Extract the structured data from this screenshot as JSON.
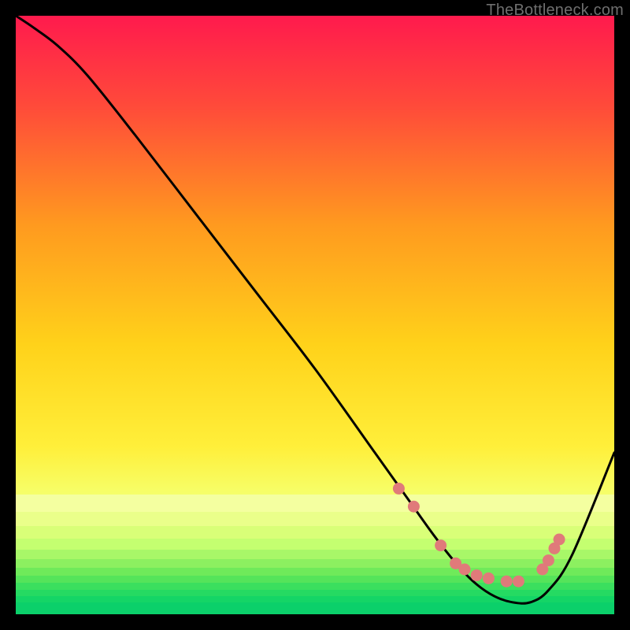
{
  "attribution": "TheBottleneck.com",
  "colors": {
    "gradient_top": "#ff1a4d",
    "gradient_mid_top": "#ff9a1f",
    "gradient_mid": "#ffe61a",
    "gradient_mid_bottom": "#f4ff6a",
    "gradient_bottom": "#13e06a",
    "frame": "#000000",
    "curve": "#000000",
    "dot_fill": "#e07a7a",
    "dot_stroke": "#b74b4b"
  },
  "chart_data": {
    "type": "line",
    "title": "",
    "xlabel": "",
    "ylabel": "",
    "xlim": [
      0,
      100
    ],
    "ylim": [
      0,
      100
    ],
    "series": [
      {
        "name": "bottleneck-curve",
        "x": [
          0,
          3,
          7,
          12,
          20,
          30,
          40,
          50,
          60,
          65,
          70,
          74,
          77,
          80,
          83,
          86,
          89,
          93,
          100
        ],
        "y": [
          100,
          98,
          95,
          90,
          80,
          67,
          54,
          41,
          27,
          20,
          13,
          8,
          5,
          3,
          2,
          2,
          4,
          10,
          27
        ]
      }
    ],
    "scatter_points": {
      "name": "highlighted-points",
      "x": [
        64,
        66.5,
        71,
        73.5,
        75,
        77,
        79,
        82,
        84,
        88,
        89,
        90,
        90.8
      ],
      "y": [
        21,
        18,
        11.5,
        8.5,
        7.5,
        6.5,
        6,
        5.5,
        5.5,
        7.5,
        9,
        11,
        12.5
      ]
    }
  }
}
